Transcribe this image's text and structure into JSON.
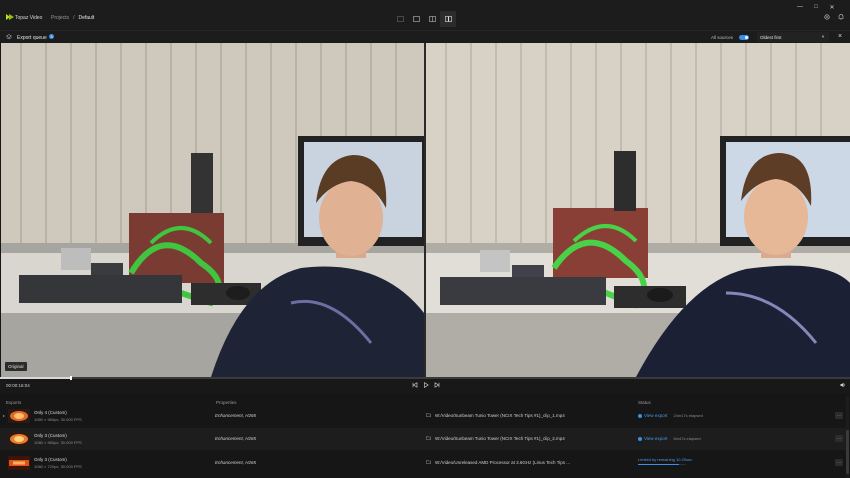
{
  "app": {
    "name": "Topaz Video"
  },
  "breadcrumb": {
    "projects": "Projects",
    "separator": "/",
    "current": "Default"
  },
  "window": {
    "minimize": "—",
    "maximize": "□",
    "close": "✕"
  },
  "queue": {
    "label": "Export queue",
    "count": "3",
    "sources_label": "All sources",
    "sources_enabled": true,
    "sort": "Oldest first"
  },
  "preview": {
    "original_tag": "Original"
  },
  "timeline": {
    "time": "00:00:16:04",
    "progress": 0.083
  },
  "exports": {
    "headers": {
      "exports": "Exports",
      "properties": "Properties",
      "status": "Status"
    },
    "rows": [
      {
        "name": "Only 4 (Custom)",
        "spec": "1080 × 960px, 30.000 FPS",
        "properties": "Enhancement, H265",
        "path": "W:/Video/Sunbeam Tunio Tower (NCIX Tech Tips #1)_clip_1.mp4",
        "status_link": "View export",
        "elapsed": "24m17s elapsed"
      },
      {
        "name": "Only 3 (Custom)",
        "spec": "1080 × 960px, 30.000 FPS",
        "properties": "Enhancement, H265",
        "path": "W:/Video/Sunbeam Tunio Tower (NCIX Tech Tips #1)_clip_2.mp4",
        "status_link": "View export",
        "elapsed": "6m47s elapsed"
      },
      {
        "name": "Only 3 (Custom)",
        "spec": "1080 × 720px, 30.000 FPS",
        "properties": "Enhancement, H265",
        "path": "W:/Video/Unreleased AMD Processor at 3.6GHz (Linus Tech Tips ...",
        "progress_text": "Limited by remaining 10.20sec",
        "progress": 0.85
      }
    ]
  },
  "colors": {
    "accent": "#3a8ee6",
    "logo": "#b9e020"
  }
}
